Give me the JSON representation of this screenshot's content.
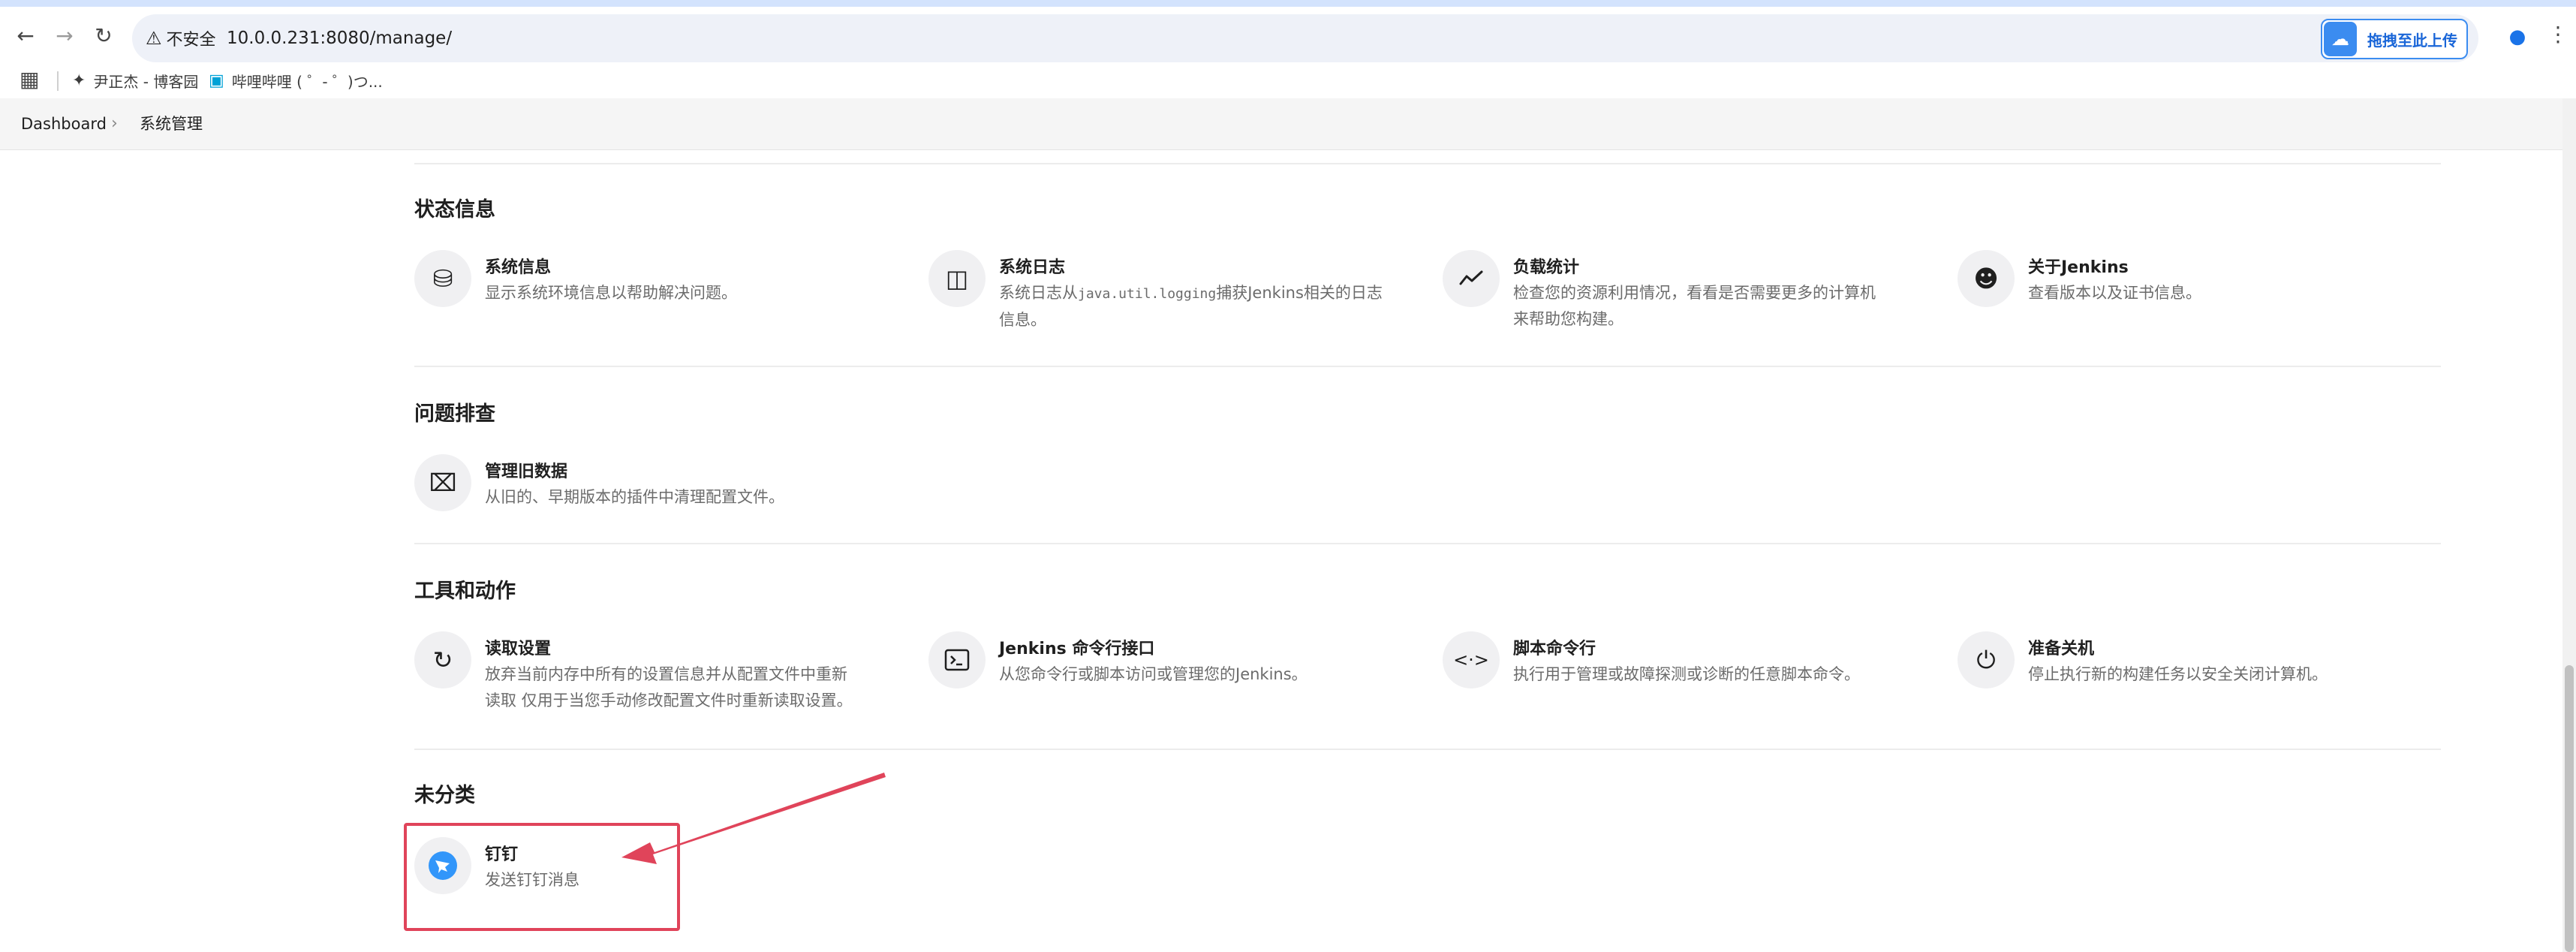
{
  "browser": {
    "back_icon": "back-arrow-icon",
    "forward_icon": "forward-arrow-icon",
    "reload_icon": "reload-icon",
    "insecure_label": "不安全",
    "url": "10.0.0.231:8080/manage/",
    "extension_label": "拖拽至此上传",
    "profile_icon": "person-icon",
    "menu_icon": "kebab-menu-icon"
  },
  "bookmarks": {
    "items": [
      {
        "label": "尹正杰 - 博客园",
        "icon": "cnblogs-icon"
      },
      {
        "label": "哔哩哔哩 ( ゜- ゜)つ...",
        "icon": "bilibili-icon"
      }
    ]
  },
  "breadcrumb": {
    "items": [
      "Dashboard",
      "系统管理"
    ]
  },
  "sections": [
    {
      "title": "状态信息",
      "items": [
        {
          "title": "系统信息",
          "desc": "显示系统环境信息以帮助解决问题。",
          "icon": "database-icon"
        },
        {
          "title": "系统日志",
          "desc_pre": "系统日志从",
          "desc_code": "java.util.logging",
          "desc_post": "捕获Jenkins相关的日志",
          "desc_line2": "信息。",
          "icon": "log-panel-icon"
        },
        {
          "title": "负载统计",
          "desc": "检查您的资源利用情况，看看是否需要更多的计算机",
          "desc_line2": "来帮助您构建。",
          "icon": "trend-line-icon"
        },
        {
          "title": "关于Jenkins",
          "desc": "查看版本以及证书信息。",
          "icon": "jenkins-butler-icon"
        }
      ]
    },
    {
      "title": "问题排查",
      "items": [
        {
          "title": "管理旧数据",
          "desc": "从旧的、早期版本的插件中清理配置文件。",
          "icon": "archive-box-icon"
        }
      ]
    },
    {
      "title": "工具和动作",
      "items": [
        {
          "title": "读取设置",
          "desc": "放弃当前内存中所有的设置信息并从配置文件中重新",
          "desc_line2": "读取 仅用于当您手动修改配置文件时重新读取设置。",
          "icon": "reload-icon"
        },
        {
          "title": "Jenkins 命令行接口",
          "desc": "从您命令行或脚本访问或管理您的Jenkins。",
          "icon": "terminal-icon"
        },
        {
          "title": "脚本命令行",
          "desc": "执行用于管理或故障探测或诊断的任意脚本命令。",
          "icon": "code-brackets-icon"
        },
        {
          "title": "准备关机",
          "desc": "停止执行新的构建任务以安全关闭计算机。",
          "icon": "power-icon"
        }
      ]
    },
    {
      "title": "未分类",
      "items": [
        {
          "title": "钉钉",
          "desc": "发送钉钉消息",
          "icon": "dingtalk-icon"
        }
      ]
    }
  ],
  "annotation": {
    "color": "#e0445a"
  }
}
